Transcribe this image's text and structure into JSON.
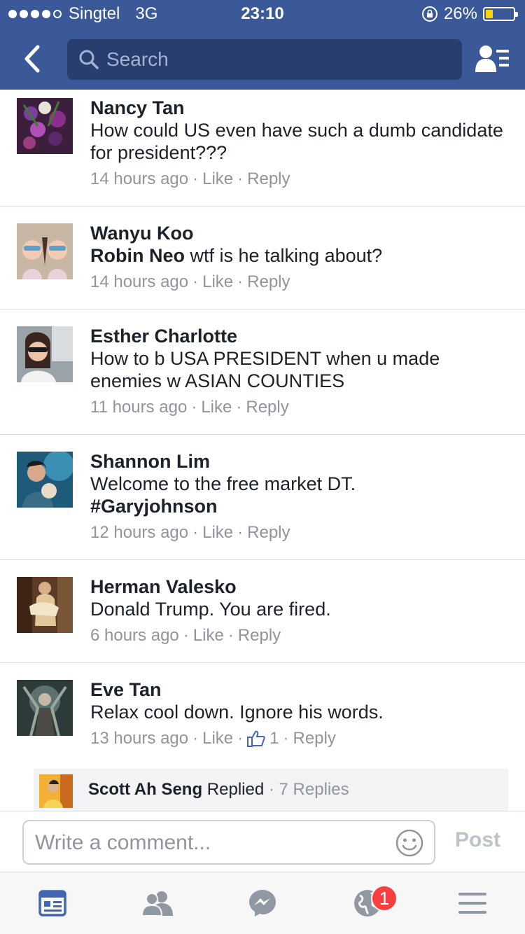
{
  "status_bar": {
    "carrier": "Singtel",
    "network": "3G",
    "time": "23:10",
    "battery": "26%",
    "battery_level": 0.26,
    "signal_bars": 4
  },
  "header": {
    "search_placeholder": "Search",
    "accent_color": "#3b5998"
  },
  "comments": [
    {
      "name": "Nancy Tan",
      "mention": "",
      "text": "How could US even have such a dumb candidate for president???",
      "time": "14 hours ago",
      "like": "Like",
      "reply": "Reply"
    },
    {
      "name": "Wanyu Koo",
      "mention": "Robin Neo",
      "text": " wtf is he talking about?",
      "time": "14 hours ago",
      "like": "Like",
      "reply": "Reply"
    },
    {
      "name": "Esther Charlotte",
      "mention": "",
      "text": "How to b USA PRESIDENT when u made enemies w ASIAN COUNTIES",
      "time": "11 hours ago",
      "like": "Like",
      "reply": "Reply"
    },
    {
      "name": "Shannon Lim",
      "mention": "",
      "text": "Welcome to the free market DT. ",
      "hashtag": "#Garyjohnson",
      "time": "12 hours ago",
      "like": "Like",
      "reply": "Reply"
    },
    {
      "name": "Herman Valesko",
      "mention": "",
      "text": "Donald Trump. You are fired.",
      "time": "6 hours ago",
      "like": "Like",
      "reply": "Reply"
    },
    {
      "name": "Eve Tan",
      "mention": "",
      "text": "Relax cool down. Ignore his words.",
      "time": "13 hours ago",
      "like": "Like",
      "like_count": "1",
      "reply": "Reply"
    }
  ],
  "reply_preview": {
    "name": "Scott Ah Seng",
    "action": "Replied",
    "count": "7 Replies"
  },
  "composer": {
    "placeholder": "Write a comment...",
    "post_label": "Post"
  },
  "tabs": [
    {
      "icon": "news-feed-icon",
      "active": true
    },
    {
      "icon": "friend-requests-icon",
      "active": false
    },
    {
      "icon": "messenger-icon",
      "active": false
    },
    {
      "icon": "notifications-globe-icon",
      "active": false,
      "badge": "1"
    },
    {
      "icon": "menu-icon",
      "active": false
    }
  ]
}
